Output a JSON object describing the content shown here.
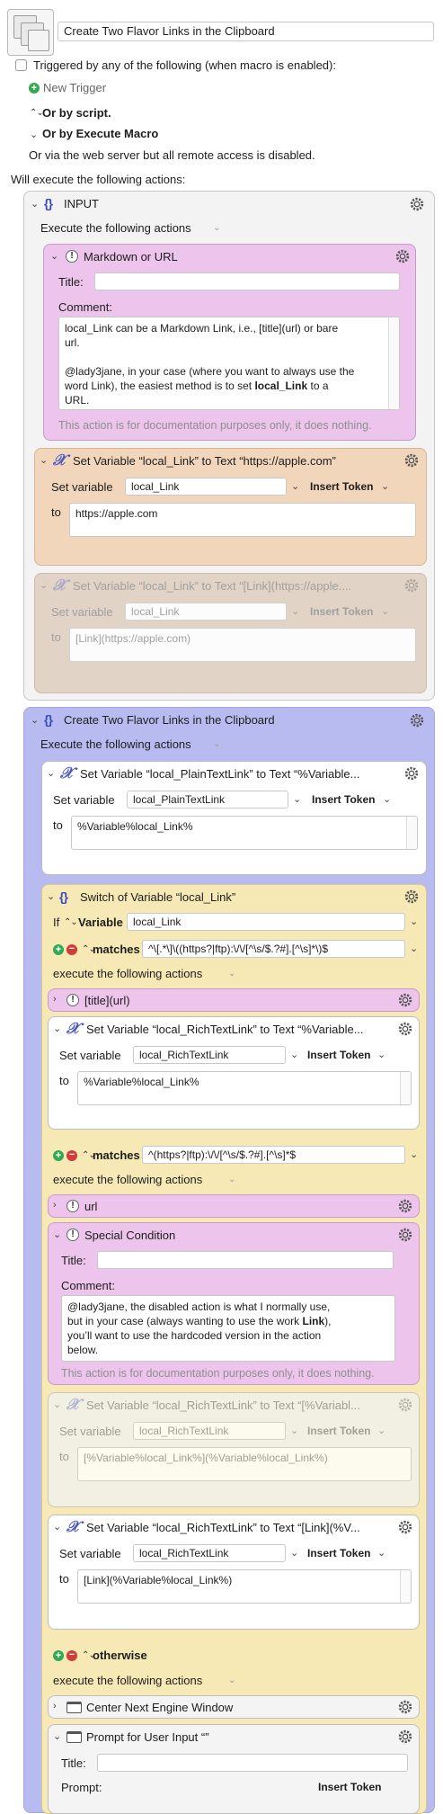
{
  "header": {
    "macro_name": "Create Two Flavor Links in the Clipboard",
    "trigger_label": "Triggered by any of the following (when macro is enabled):",
    "new_trigger": "New Trigger",
    "by_script": "Or by script.",
    "by_execute": "Or by Execute Macro",
    "web_server": "Or via the web server but all remote access is disabled.",
    "will_execute": "Will execute the following actions:"
  },
  "group_input": {
    "title": "INPUT",
    "execute_label": "Execute the following actions",
    "comment_action": {
      "title": "Markdown or URL",
      "title_label": "Title:",
      "title_value": "",
      "comment_label": "Comment:",
      "comment_line1": "local_Link can be a Markdown Link, i.e., [title](url) or bare",
      "comment_line2": "url.",
      "comment_line3": "@lady3jane, in your case (where you want to always use the",
      "comment_line4": "word Link), the easiest method is to set",
      "comment_bold": "local_Link",
      "comment_line4b": "to a",
      "comment_line5": "URL.",
      "footnote": "This action is for documentation purposes only, it does nothing."
    },
    "setvar1": {
      "title": "Set Variable “local_Link” to Text “https://apple.com”",
      "set_label": "Set variable",
      "var": "local_Link",
      "insert_token": "Insert Token",
      "to_label": "to",
      "value": "https://apple.com"
    },
    "setvar2": {
      "title": "Set Variable “local_Link” to Text “[Link](https://apple....",
      "set_label": "Set variable",
      "var": "local_Link",
      "insert_token": "Insert Token",
      "to_label": "to",
      "value": "[Link](https://apple.com)"
    }
  },
  "group_main": {
    "title": "Create Two Flavor Links in the Clipboard",
    "execute_label": "Execute the following actions",
    "setvar_plain": {
      "title": "Set Variable “local_PlainTextLink” to Text “%Variable...",
      "set_label": "Set variable",
      "var": "local_PlainTextLink",
      "insert_token": "Insert Token",
      "to_label": "to",
      "value": "%Variable%local_Link%"
    },
    "switch": {
      "title": "Switch of Variable “local_Link”",
      "if_label": "If",
      "variable_label": "Variable",
      "var": "local_Link",
      "case1": {
        "matches": "matches",
        "pattern": "^\\[.*\\]\\((https?|ftp):\\/\\/[^\\s/$.?#].[^\\s]*\\)$",
        "execute_label": "execute the following actions",
        "comment_title": "[title](url)",
        "setvar": {
          "title": "Set Variable “local_RichTextLink” to Text “%Variable...",
          "set_label": "Set variable",
          "var": "local_RichTextLink",
          "insert_token": "Insert Token",
          "to_label": "to",
          "value": "%Variable%local_Link%"
        }
      },
      "case2": {
        "matches": "matches",
        "pattern": "^(https?|ftp):\\/\\/[^\\s/$.?#].[^\\s]*$",
        "execute_label": "execute the following actions",
        "comment_title": "url",
        "special": {
          "title": "Special Condition",
          "title_label": "Title:",
          "comment_label": "Comment:",
          "line1": "@lady3jane, the disabled action is what I normally use,",
          "line2a": "but in your case (always wanting to use the work",
          "line2b": "Link",
          "line2c": "),",
          "line3": "you’ll want to use the hardcoded version in the action",
          "line4": "below.",
          "footnote": "This action is for documentation purposes only, it does nothing."
        },
        "setvar_disabled": {
          "title": "Set Variable “local_RichTextLink” to Text “[%Variabl...",
          "set_label": "Set variable",
          "var": "local_RichTextLink",
          "insert_token": "Insert Token",
          "to_label": "to",
          "value": "[%Variable%local_Link%](%Variable%local_Link%)"
        },
        "setvar_enabled": {
          "title": "Set Variable “local_RichTextLink” to Text “[Link](%V...",
          "set_label": "Set variable",
          "var": "local_RichTextLink",
          "insert_token": "Insert Token",
          "to_label": "to",
          "value": "[Link](%Variable%local_Link%)"
        }
      },
      "otherwise": {
        "label": "otherwise",
        "execute_label": "execute the following actions",
        "center_window": "Center Next Engine Window",
        "prompt": {
          "title": "Prompt for User Input “”",
          "title_label": "Title:",
          "prompt_label": "Prompt:",
          "insert_token": "Insert Token"
        }
      }
    }
  },
  "colors": {
    "purple_group": "#b7bbef",
    "comment_pink": "#ecc4ec",
    "setvar_peach": "#f2d6bb",
    "disabled_tan": "#dccbb9",
    "switch_yellow": "#f6e9b5"
  }
}
